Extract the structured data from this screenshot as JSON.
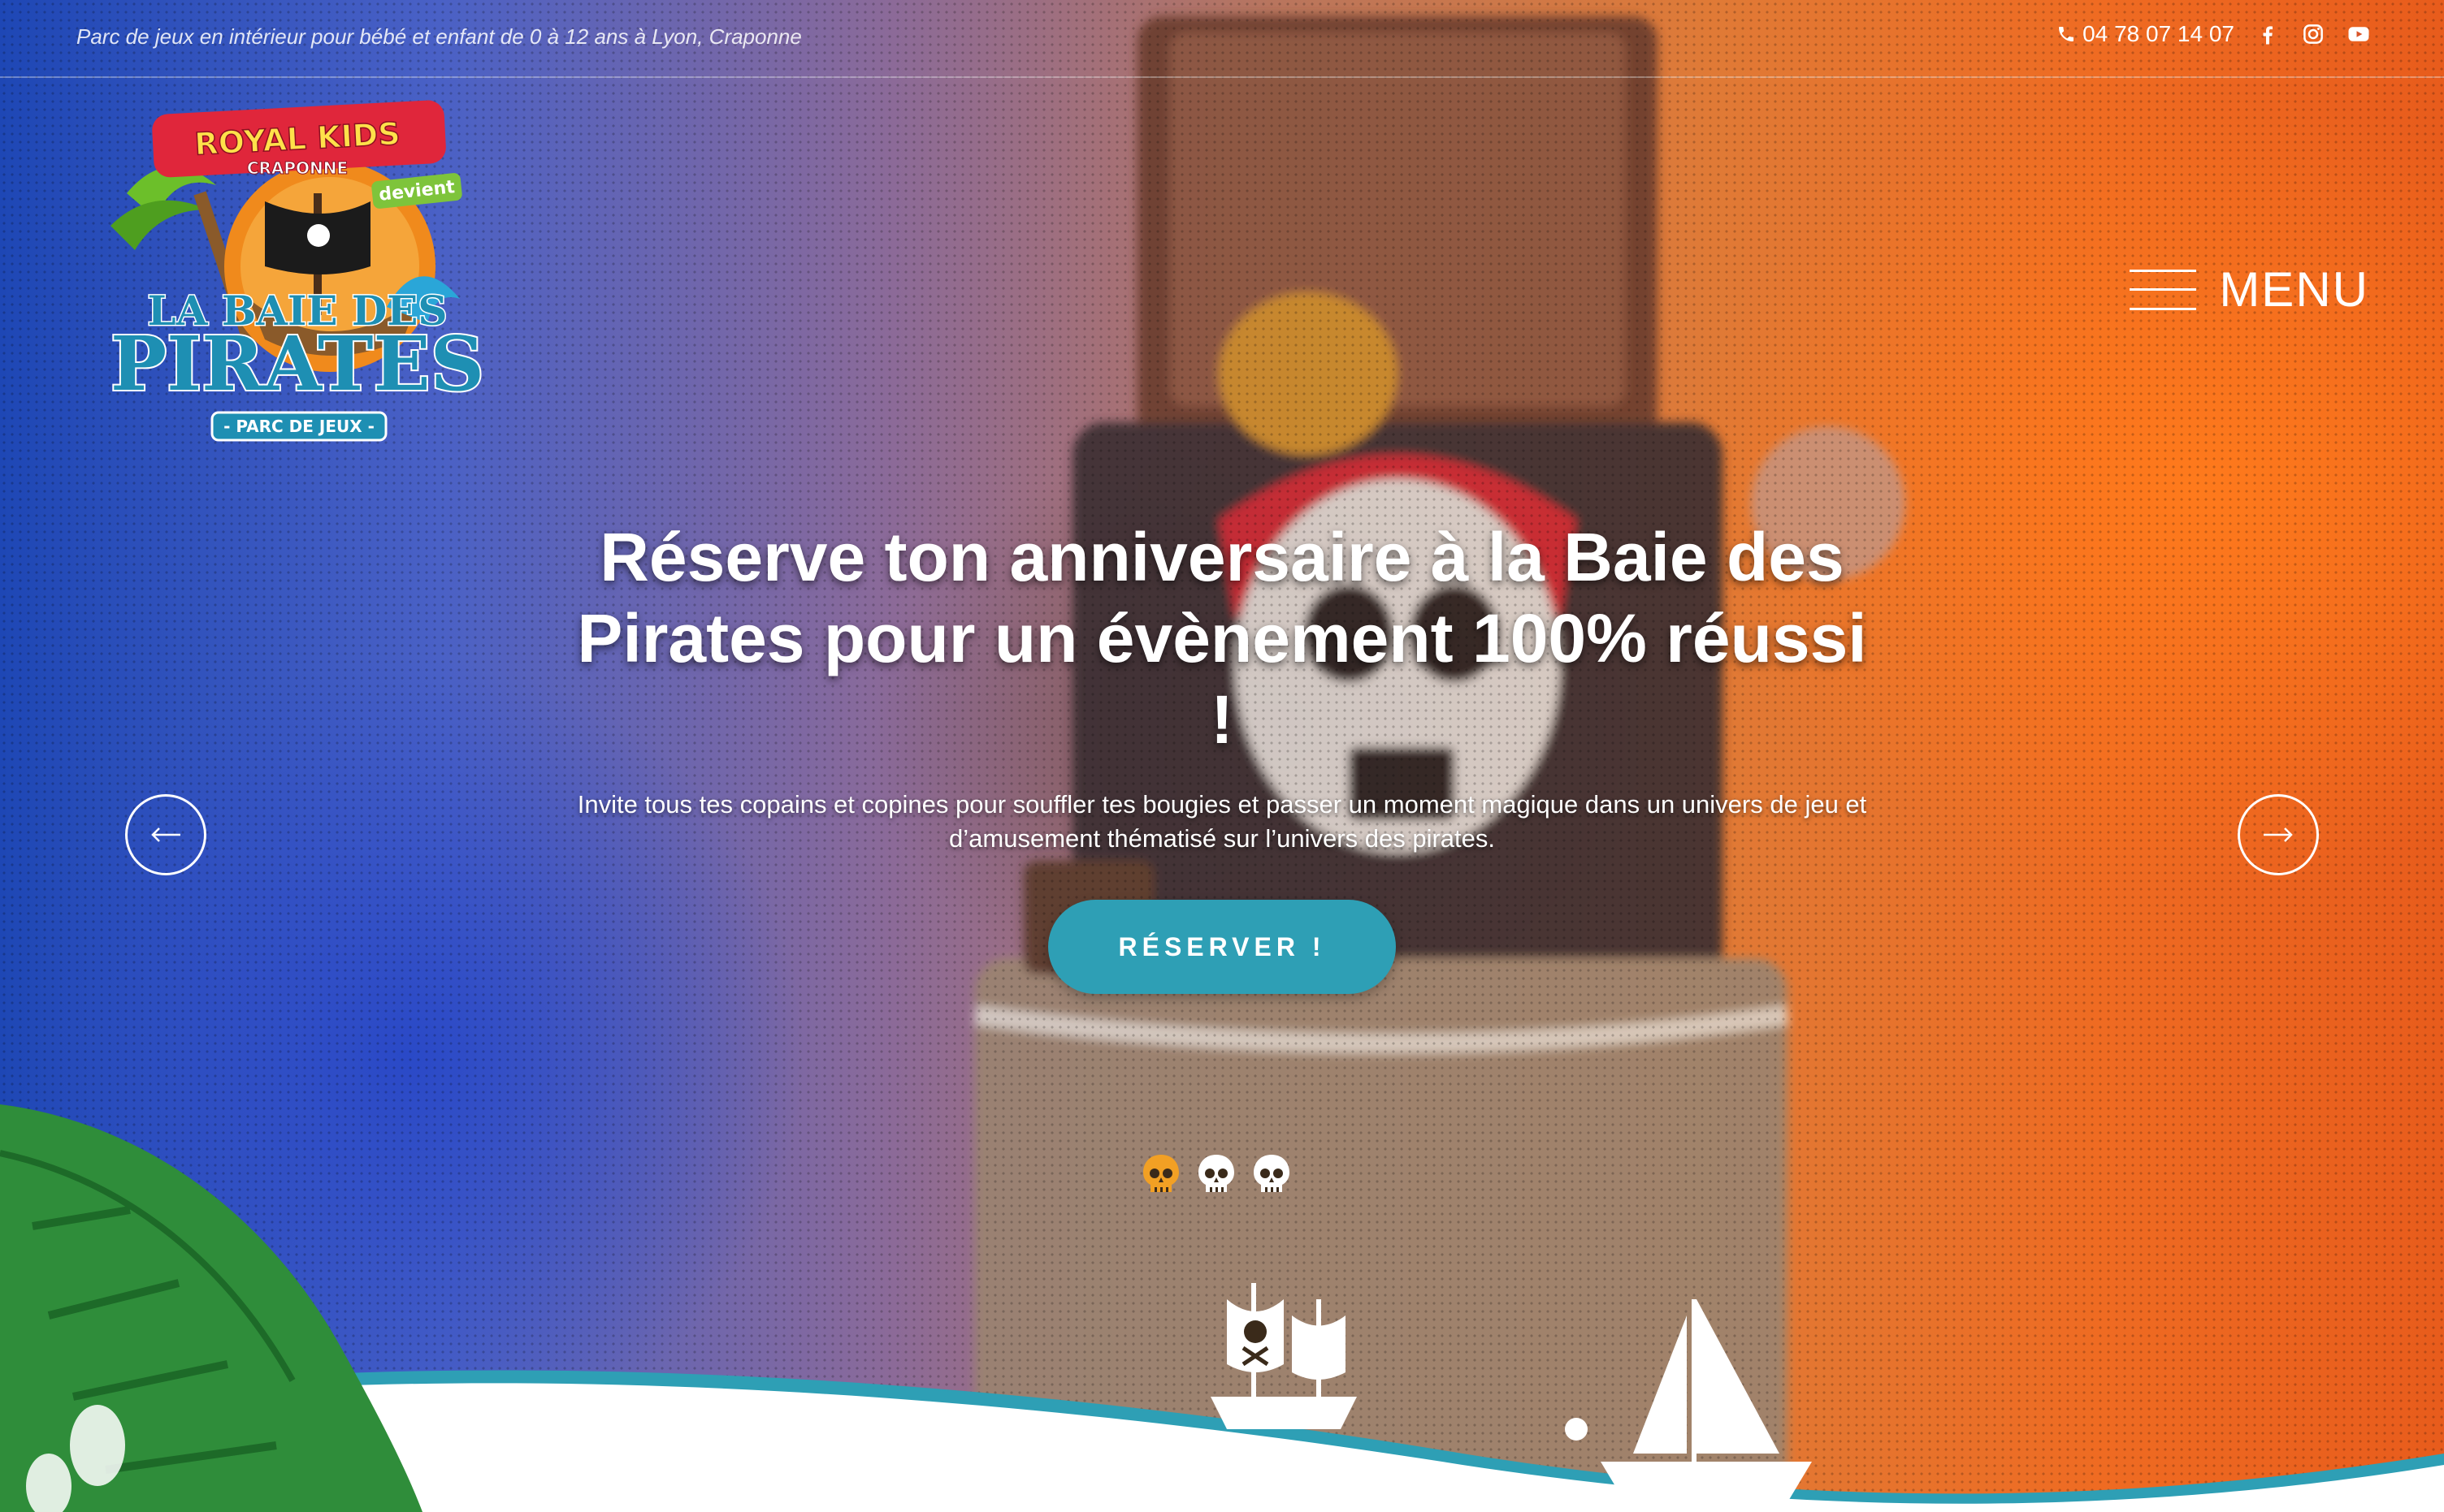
{
  "topbar": {
    "tagline": "Parc de jeux en intérieur pour bébé et enfant de 0 à 12 ans à Lyon, Craponne",
    "phone": "04 78 07 14 07",
    "social": [
      "facebook-icon",
      "instagram-icon",
      "youtube-icon"
    ]
  },
  "logo": {
    "brand_top": "ROYAL KIDS",
    "brand_sub": "CRAPONNE",
    "devient": "devient",
    "name_line1": "LA BAIE DES",
    "name_line2": "PIRATES",
    "ribbon": "- PARC DE JEUX -"
  },
  "menu": {
    "label": "MENU"
  },
  "slide": {
    "title": "Réserve ton anniversaire à la Baie des Pirates pour un évènement 100% réussi !",
    "text": "Invite tous tes copains et copines pour souffler tes bougies et passer un moment magique dans un univers de jeu et d’amusement thématisé sur l’univers des pirates.",
    "cta_label": "RÉSERVER !"
  },
  "slider": {
    "prev_icon": "arrow-left-icon",
    "next_icon": "arrow-right-icon",
    "dot_count": 3,
    "active_index": 0
  },
  "colors": {
    "accent": "#2e9fb5",
    "active_dot": "#f2a024",
    "logo_blue": "#1e8fb3",
    "logo_red": "#e0263b"
  }
}
